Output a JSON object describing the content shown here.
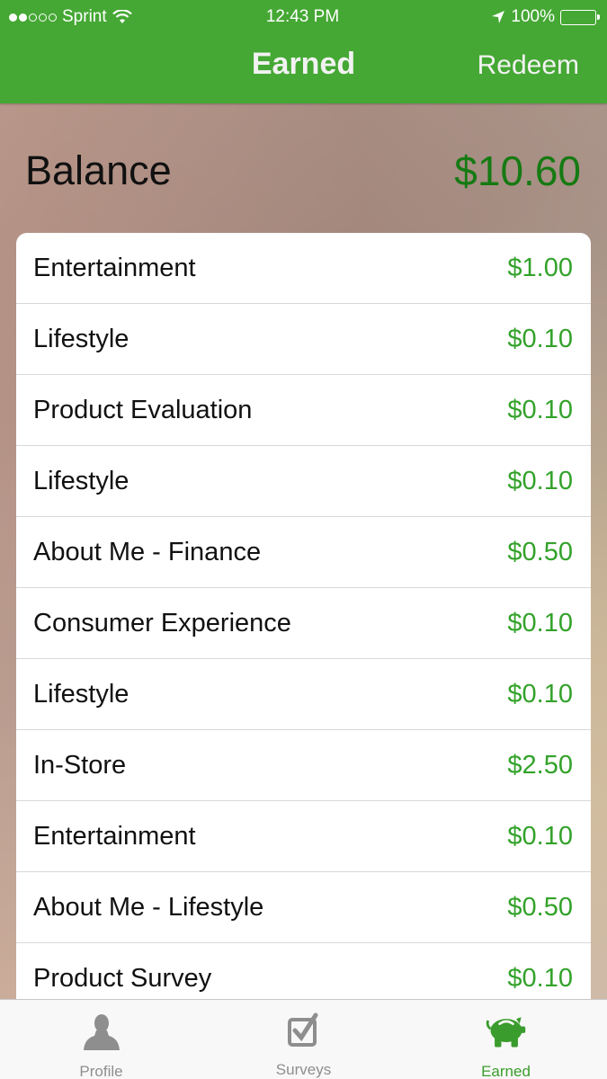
{
  "status_bar": {
    "carrier": "Sprint",
    "signal_bars_filled": 2,
    "signal_bars_total": 5,
    "time": "12:43 PM",
    "battery": "100%"
  },
  "nav": {
    "title": "Earned",
    "redeem_label": "Redeem"
  },
  "balance": {
    "label": "Balance",
    "value": "$10.60"
  },
  "items": [
    {
      "label": "Entertainment",
      "value": "$1.00"
    },
    {
      "label": "Lifestyle",
      "value": "$0.10"
    },
    {
      "label": "Product Evaluation",
      "value": "$0.10"
    },
    {
      "label": "Lifestyle",
      "value": "$0.10"
    },
    {
      "label": "About Me - Finance",
      "value": "$0.50"
    },
    {
      "label": "Consumer Experience",
      "value": "$0.10"
    },
    {
      "label": "Lifestyle",
      "value": "$0.10"
    },
    {
      "label": "In-Store",
      "value": "$2.50"
    },
    {
      "label": "Entertainment",
      "value": "$0.10"
    },
    {
      "label": "About Me - Lifestyle",
      "value": "$0.50"
    },
    {
      "label": "Product Survey",
      "value": "$0.10"
    }
  ],
  "tabs": [
    {
      "label": "Profile",
      "icon": "person-icon",
      "active": false
    },
    {
      "label": "Surveys",
      "icon": "checkbox-icon",
      "active": false
    },
    {
      "label": "Earned",
      "icon": "piggy-bank-icon",
      "active": true
    }
  ],
  "colors": {
    "brand_green": "#45a834",
    "amount_green": "#33a22a",
    "balance_green": "#157a12",
    "inactive_tab": "#8e8e8e"
  }
}
